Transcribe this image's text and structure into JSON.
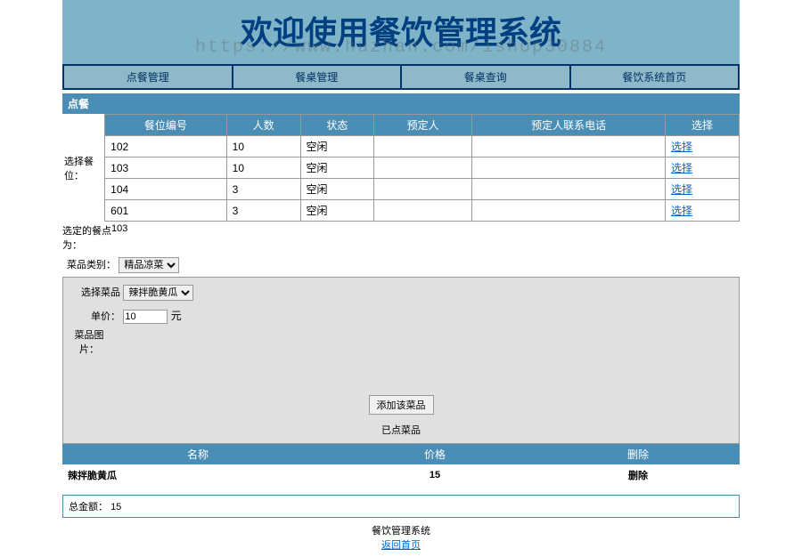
{
  "header": {
    "title": "欢迎使用餐饮管理系统",
    "watermark": "https://www.huzhan.com/ishop30884"
  },
  "nav": {
    "items": [
      "点餐管理",
      "餐桌管理",
      "餐桌查询",
      "餐饮系统首页"
    ]
  },
  "section": {
    "title": "点餐"
  },
  "table_area": {
    "side_label": "选择餐位：",
    "headers": [
      "餐位编号",
      "人数",
      "状态",
      "预定人",
      "预定人联系电话",
      "选择"
    ],
    "rows": [
      {
        "cells": [
          "102",
          "10",
          "空闲",
          "",
          ""
        ],
        "action": "选择"
      },
      {
        "cells": [
          "103",
          "10",
          "空闲",
          "",
          ""
        ],
        "action": "选择"
      },
      {
        "cells": [
          "104",
          "3",
          "空闲",
          "",
          ""
        ],
        "action": "选择"
      },
      {
        "cells": [
          "601",
          "3",
          "空闲",
          "",
          ""
        ],
        "action": "选择"
      }
    ]
  },
  "selected": {
    "label": "选定的餐点为：",
    "value": "103"
  },
  "category": {
    "label": "菜品类别：",
    "selected": "精品凉菜"
  },
  "dish": {
    "label": "选择菜品",
    "selected": "辣拌脆黄瓜"
  },
  "price": {
    "label": "单价：",
    "value": "10",
    "unit": "元"
  },
  "image": {
    "label": "菜品图片："
  },
  "add_button": "添加该菜品",
  "ordered_label": "已点菜品",
  "ordered": {
    "headers": [
      "名称",
      "价格",
      "删除"
    ],
    "rows": [
      {
        "name": "辣拌脆黄瓜",
        "price": "15",
        "del": "删除"
      }
    ]
  },
  "total": {
    "label": "总金额：",
    "value": "15"
  },
  "footer": {
    "text": "餐饮管理系统",
    "link": "返回首页"
  }
}
